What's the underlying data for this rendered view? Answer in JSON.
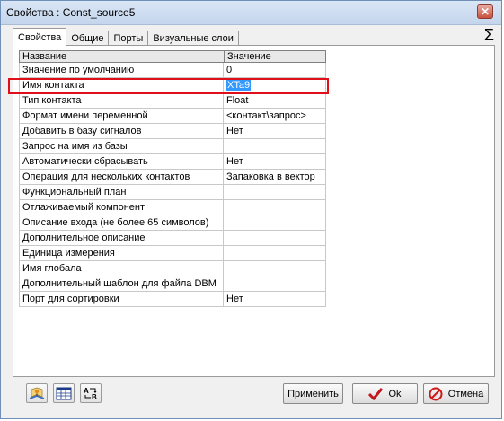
{
  "window": {
    "title": "Свойства : Const_source5",
    "close_label": "✕"
  },
  "tabs": [
    {
      "label": "Свойства",
      "active": true
    },
    {
      "label": "Общие",
      "active": false
    },
    {
      "label": "Порты",
      "active": false
    },
    {
      "label": "Визуальные слои",
      "active": false
    }
  ],
  "sigma_label": "Σ",
  "grid": {
    "headers": [
      "Название",
      "Значение"
    ],
    "rows": [
      {
        "name": "Значение по умолчанию",
        "value": "0"
      },
      {
        "name": "Имя контакта",
        "value": "XTa9"
      },
      {
        "name": "Тип контакта",
        "value": "Float"
      },
      {
        "name": "Формат имени переменной",
        "value": "<контакт\\запрос>"
      },
      {
        "name": "Добавить в базу сигналов",
        "value": "Нет"
      },
      {
        "name": "Запрос на имя из базы",
        "value": ""
      },
      {
        "name": "Автоматически сбрасывать",
        "value": "Нет"
      },
      {
        "name": "Операция для нескольких контактов",
        "value": "Запаковка в вектор"
      },
      {
        "name": "Функциональный план",
        "value": ""
      },
      {
        "name": "Отлаживаемый компонент",
        "value": ""
      },
      {
        "name": "Описание входа (не более 65 символов)",
        "value": ""
      },
      {
        "name": "Дополнительное описание",
        "value": ""
      },
      {
        "name": "Единица измерения",
        "value": ""
      },
      {
        "name": "Имя глобала",
        "value": ""
      },
      {
        "name": "Дополнительный шаблон для файла DBM",
        "value": ""
      },
      {
        "name": "Порт для сортировки",
        "value": "Нет"
      }
    ]
  },
  "buttons": {
    "apply": "Применить",
    "ok": "Ok",
    "cancel": "Отмена"
  },
  "colors": {
    "selection": "#3399ff",
    "highlight_outline": "#e0101a",
    "ok_check": "#c0181e",
    "cancel_icon": "#d01818"
  }
}
